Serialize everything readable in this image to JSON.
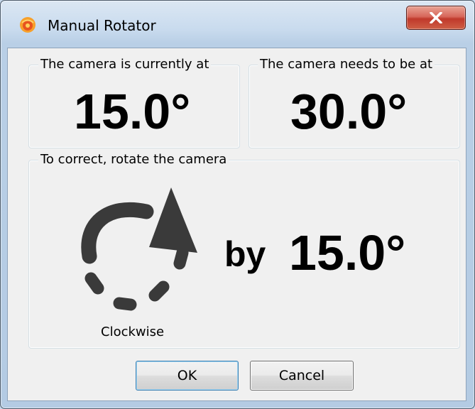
{
  "window": {
    "title": "Manual Rotator",
    "icon": "orange-sun-icon",
    "close_symbol": "X"
  },
  "current": {
    "legend": "The camera is currently at",
    "value": "15.0°"
  },
  "target": {
    "legend": "The camera needs to be at",
    "value": "30.0°"
  },
  "correction": {
    "legend": "To correct, rotate the camera",
    "by_label": "by",
    "value": "15.0°",
    "direction": "Clockwise",
    "direction_icon": "clockwise-arrow-icon"
  },
  "buttons": {
    "ok": "OK",
    "cancel": "Cancel"
  },
  "colors": {
    "arrow": "#3a3a3a",
    "close_button": "#c0392b",
    "dialog_background": "#f0f0f0"
  }
}
